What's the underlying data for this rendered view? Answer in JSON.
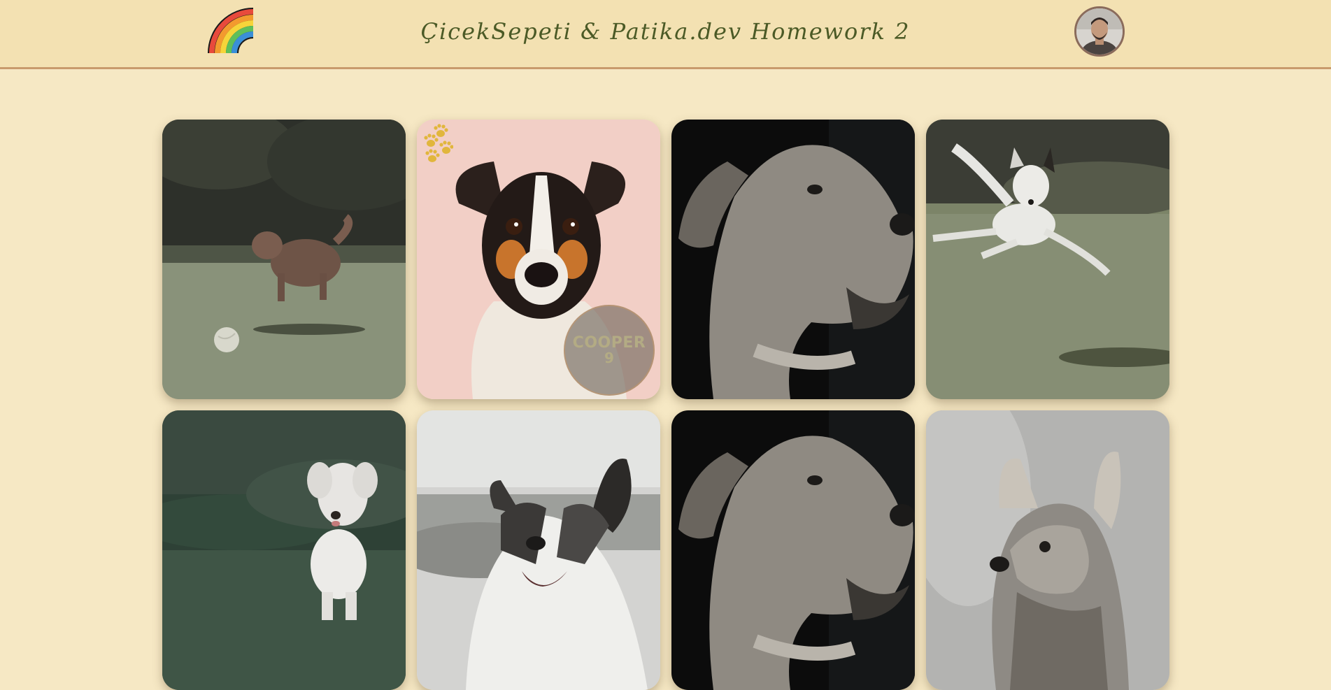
{
  "header": {
    "title": "ÇicekSepeti & Patika.dev Homework 2",
    "logo_icon": "rainbow-icon",
    "avatar_icon": "user-avatar"
  },
  "colors": {
    "page_background": "#f6e8c4",
    "header_background": "#f3e1b2",
    "header_border": "#c89a6c",
    "title_text": "#4b5a26",
    "badge_text": "#b3ab84"
  },
  "gallery": {
    "cards": [
      {
        "subject": "poodle-running-photo"
      },
      {
        "subject": "terrier-portrait-photo",
        "badge": {
          "name": "COOPER",
          "number": "9"
        },
        "decoration": "paw-prints-icon"
      },
      {
        "subject": "labrador-profile-photo"
      },
      {
        "subject": "white-dog-jumping-photo"
      },
      {
        "subject": "maltese-running-photo"
      },
      {
        "subject": "collie-smiling-photo"
      },
      {
        "subject": "labrador-profile-photo"
      },
      {
        "subject": "yorkshire-terrier-photo"
      }
    ]
  }
}
